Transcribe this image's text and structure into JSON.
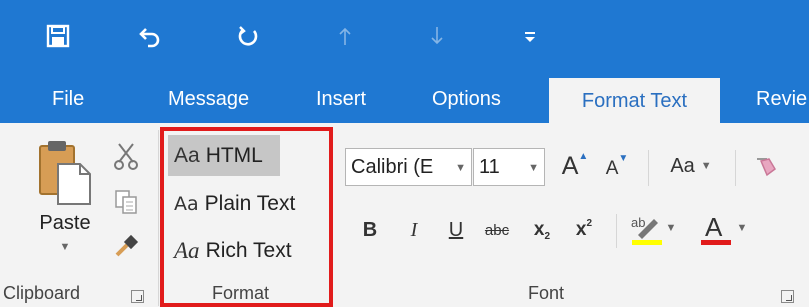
{
  "quick_access": {
    "save_icon": "save-icon",
    "undo_icon": "undo-icon",
    "redo_icon": "redo-icon",
    "up_icon": "up-arrow-icon",
    "down_icon": "down-arrow-icon",
    "more_icon": "customize-icon"
  },
  "tabs": {
    "file": "File",
    "message": "Message",
    "insert": "Insert",
    "options": "Options",
    "format_text": "Format Text",
    "review": "Revie"
  },
  "clipboard": {
    "paste": "Paste",
    "label": "Clipboard"
  },
  "format": {
    "html_prefix": "Aa",
    "html": "HTML",
    "plain_prefix": "Aa",
    "plain": "Plain Text",
    "rich_prefix": "Aa",
    "rich": "Rich Text",
    "label": "Format"
  },
  "font": {
    "name": "Calibri (E",
    "size": "11",
    "change_case": "Aa",
    "bold": "B",
    "italic": "I",
    "underline": "U",
    "strikethrough": "abc",
    "subscript": "x",
    "superscript": "x",
    "label": "Font"
  },
  "colors": {
    "titlebar": "#1f78d2",
    "active_tab_text": "#2a6fc0",
    "highlight": "#ffff00",
    "font_color": "#e11b1b",
    "format_box": "#e11b1b"
  }
}
